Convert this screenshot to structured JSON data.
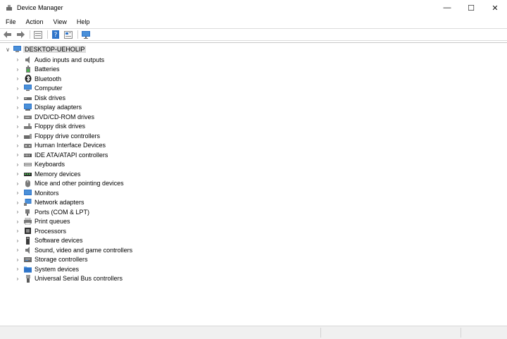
{
  "window": {
    "title": "Device Manager",
    "minimize_glyph": "—",
    "maximize_glyph": "☐",
    "close_glyph": "✕"
  },
  "menu": [
    "File",
    "Action",
    "View",
    "Help"
  ],
  "toolbar": {
    "buttons": [
      "back-arrow-icon",
      "forward-arrow-icon",
      "properties-icon",
      "help-icon",
      "update-driver-icon",
      "scan-monitor-icon"
    ]
  },
  "tree": {
    "root": "DESKTOP-UEHOLIP",
    "items": [
      {
        "label": "Audio inputs and outputs",
        "icon": "speaker-icon"
      },
      {
        "label": "Batteries",
        "icon": "battery-icon"
      },
      {
        "label": "Bluetooth",
        "icon": "bluetooth-icon"
      },
      {
        "label": "Computer",
        "icon": "computer-icon"
      },
      {
        "label": "Disk drives",
        "icon": "disk-drive-icon"
      },
      {
        "label": "Display adapters",
        "icon": "display-adapter-icon"
      },
      {
        "label": "DVD/CD-ROM drives",
        "icon": "dvd-drive-icon"
      },
      {
        "label": "Floppy disk drives",
        "icon": "floppy-disk-icon"
      },
      {
        "label": "Floppy drive controllers",
        "icon": "floppy-controller-icon"
      },
      {
        "label": "Human Interface Devices",
        "icon": "hid-icon"
      },
      {
        "label": "IDE ATA/ATAPI controllers",
        "icon": "ide-controller-icon"
      },
      {
        "label": "Keyboards",
        "icon": "keyboard-icon"
      },
      {
        "label": "Memory devices",
        "icon": "memory-icon"
      },
      {
        "label": "Mice and other pointing devices",
        "icon": "mouse-icon"
      },
      {
        "label": "Monitors",
        "icon": "monitor-icon"
      },
      {
        "label": "Network adapters",
        "icon": "network-icon"
      },
      {
        "label": "Ports (COM & LPT)",
        "icon": "port-icon"
      },
      {
        "label": "Print queues",
        "icon": "printer-icon"
      },
      {
        "label": "Processors",
        "icon": "processor-icon"
      },
      {
        "label": "Software devices",
        "icon": "software-device-icon"
      },
      {
        "label": "Sound, video and game controllers",
        "icon": "sound-icon"
      },
      {
        "label": "Storage controllers",
        "icon": "storage-controller-icon"
      },
      {
        "label": "System devices",
        "icon": "system-folder-icon"
      },
      {
        "label": "Universal Serial Bus controllers",
        "icon": "usb-icon"
      }
    ]
  },
  "colors": {
    "selection": "#dcdcdc",
    "accent_blue": "#2e74c9"
  }
}
